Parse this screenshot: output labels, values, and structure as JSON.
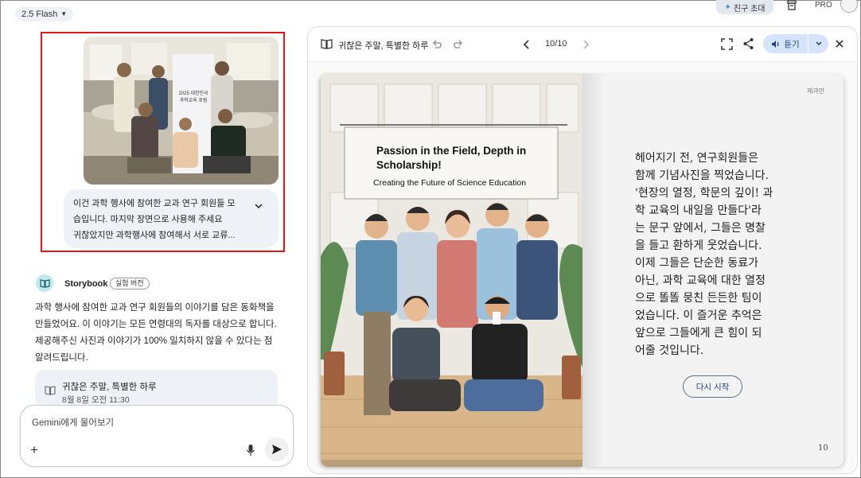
{
  "topbar": {
    "model_label": "2.5 Flash",
    "invite_label": "친구 초대",
    "pro_label": "PRO"
  },
  "chat": {
    "user_message": {
      "lines": [
        "이건 과학 행사에 참여한 교과 연구 회원들 모",
        "습입니다. 마지막 장면으로 사용해 주세요",
        "귀찮았지만 과학행사에 참여해서 서로 교류..."
      ],
      "photo_banner": [
        "2025 대한민국",
        "과학교육 포럼"
      ]
    },
    "assistant": {
      "name": "Storybook",
      "badge": "실험 버전",
      "reply_lines": [
        "과학 행사에 참여한 교과 연구 회원들의 이야기를 담은 동화책을",
        "만들었어요. 이 이야기는 모든 연령대의 독자를 대상으로 합니다.",
        "제공해주신 사진과 이야기가 100% 일치하지 않을 수 있다는 점",
        "알려드립니다."
      ],
      "story_card": {
        "title": "귀찮은 주말, 특별한 하루",
        "date": "8월 8일 오전 11:30"
      }
    },
    "input_placeholder": "Gemini에게 물어보기"
  },
  "viewer": {
    "title": "귀찮은 주말, 특별한 하루",
    "page_indicator": "10/10",
    "listen_label": "듣기",
    "left_page": {
      "banner_title_1": "Passion in the Field, Depth in",
      "banner_title_2": "Scholarship!",
      "banner_subtitle": "Creating the Future of Science Education"
    },
    "right_page": {
      "header": "재과만",
      "text_lines": [
        "헤어지기 전, 연구회원들은",
        "함께 기념사진을 찍었습니다.",
        "'현장의 열정, 학문의 깊이! 과",
        "학 교육의 내일을 만들다'라",
        "는 문구 앞에서, 그들은 명찰",
        "을 들고 환하게 웃었습니다.",
        "이제 그들은 단순한 동료가",
        "아닌, 과학 교육에 대한 열정",
        "으로 똘똘 뭉친 든든한 팀이",
        "었습니다. 이 즐거운 추억은",
        "앞으로 그들에게 큰 힘이 되",
        "어줄 것입니다."
      ],
      "restart_label": "다시 시작",
      "page_number": "10"
    }
  },
  "colors": {
    "highlight_border": "#e0161b",
    "listen_button_bg": "#d6e4fb",
    "accent_blue": "#1b3f86",
    "storybook_logo_bg": "#bfe9ec"
  }
}
